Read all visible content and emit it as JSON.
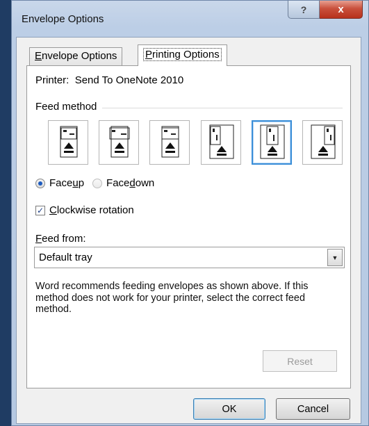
{
  "window": {
    "title": "Envelope Options",
    "help_glyph": "?",
    "close_glyph": "x"
  },
  "tabs": [
    {
      "label": "Envelope Options",
      "accel": "E",
      "rest": "nvelope Options",
      "active": false
    },
    {
      "label": "Printing Options",
      "accel": "P",
      "rest": "rinting Options",
      "active": true
    }
  ],
  "printer": {
    "label": "Printer:",
    "value": "Send To OneNote 2010"
  },
  "feed_method": {
    "label": "Feed method",
    "options": [
      {
        "name": "horizontal-left",
        "selected": false
      },
      {
        "name": "horizontal-center",
        "selected": false
      },
      {
        "name": "horizontal-right",
        "selected": false
      },
      {
        "name": "vertical-left",
        "selected": false
      },
      {
        "name": "vertical-center",
        "selected": true
      },
      {
        "name": "vertical-right",
        "selected": false
      }
    ]
  },
  "face": {
    "up": {
      "pre": "Face ",
      "accel": "u",
      "post": "p",
      "label": "Face up",
      "checked": true
    },
    "down": {
      "pre": "Face ",
      "accel": "d",
      "post": "own",
      "label": "Face down",
      "checked": false
    }
  },
  "clockwise": {
    "accel": "C",
    "rest": "lockwise rotation",
    "label": "Clockwise rotation",
    "checked": true
  },
  "feed_from": {
    "accel": "F",
    "rest": "eed from:",
    "label": "Feed from:",
    "value": "Default tray"
  },
  "note": "Word recommends feeding envelopes as shown above. If this method does not work for your printer, select the correct feed method.",
  "buttons": {
    "reset": "Reset",
    "ok": "OK",
    "cancel": "Cancel"
  },
  "colors": {
    "selection_border": "#3a8ed8",
    "close_button": "#c9503c"
  }
}
